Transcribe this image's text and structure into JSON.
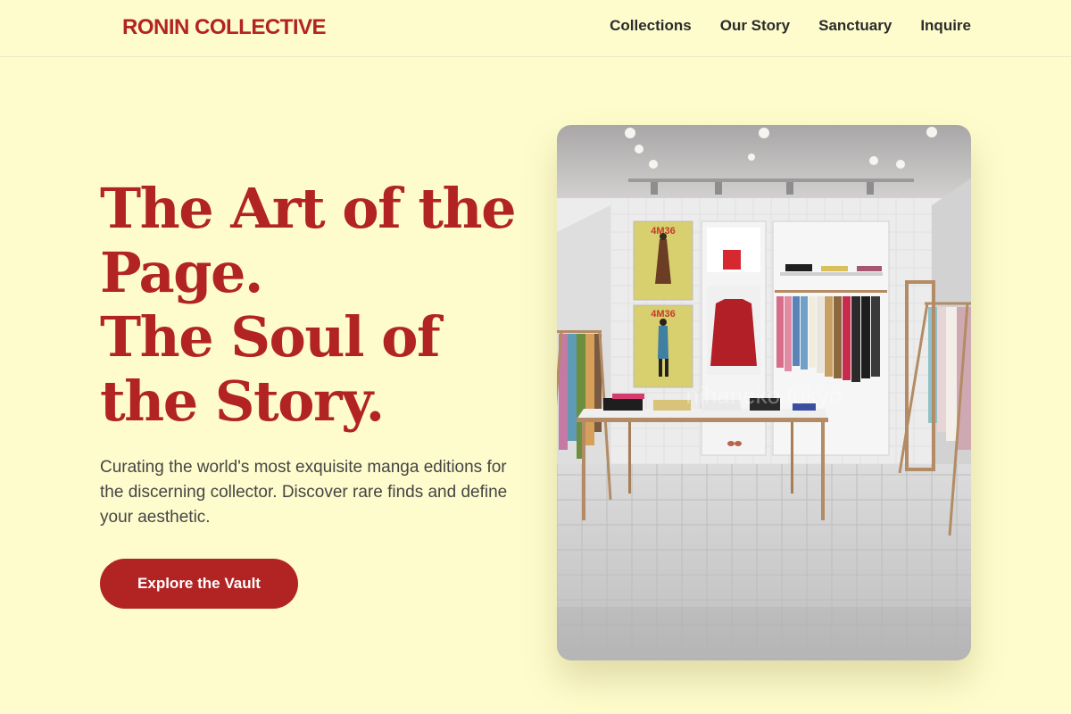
{
  "brand": {
    "name": "RONIN COLLECTIVE",
    "accent_color": "#b22424",
    "background_color": "#fefccc"
  },
  "nav": {
    "items": [
      {
        "label": "Collections"
      },
      {
        "label": "Our Story"
      },
      {
        "label": "Sanctuary"
      },
      {
        "label": "Inquire"
      }
    ]
  },
  "hero": {
    "title_lines": [
      "The Art of the",
      "Page.",
      "The Soul of",
      "the Story."
    ],
    "subtitle": "Curating the world's most exquisite manga editions for the discerning collector. Discover rare finds and define your aesthetic.",
    "cta_label": "Explore the Vault"
  },
  "image": {
    "poster_labels": [
      "4M36",
      "4M36"
    ],
    "watermark": "nihaneko.tokyo"
  }
}
